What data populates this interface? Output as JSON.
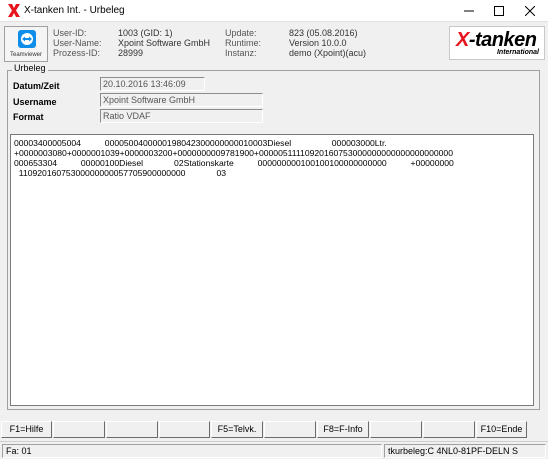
{
  "window": {
    "title": "X-tanken Int. - Urbeleg",
    "icons": {
      "app": "x-logo-icon",
      "minimize": "minimize-icon",
      "maximize": "maximize-icon",
      "close": "close-icon"
    }
  },
  "header": {
    "teamviewer_label": "Teamviewer",
    "teamviewer_icon": "teamviewer-icon",
    "user_id_label": "User-ID:",
    "user_id_value": "1003 (GID: 1)",
    "user_name_label": "User-Name:",
    "user_name_value": "Xpoint Software GmbH",
    "process_id_label": "Prozess-ID:",
    "process_id_value": "28999",
    "update_label": "Update:",
    "update_value": "823 (05.08.2016)",
    "runtime_label": "Runtime:",
    "runtime_value": "Version 10.0.0",
    "instance_label": "Instanz:",
    "instance_value": "demo (Xpoint)(acu)",
    "brand_x": "X",
    "brand_rest": "-tanken",
    "brand_sub": "International",
    "brand_color": "#e8141d"
  },
  "urbeleg": {
    "group_title": "Urbeleg",
    "datetime_label": "Datum/Zeit",
    "datetime_value": "20.10.2016 13:46:09",
    "username_label": "Username",
    "username_value": "Xpoint Software GmbH",
    "format_label": "Format",
    "format_value": "Ratio VDAF",
    "raw_lines": [
      "00003400005004          0000500400000198042300000000010003Diesel                 000003000Ltr.",
      "+0000003080+0000001039+0000003200+0000000009781900+00000511110920160753000000000000000000000",
      "000653304          00000100Diesel             02Stationskarte          000000000100100100000000000          +00000000",
      "  11092016075300000000057705900000000             03"
    ]
  },
  "fkeys": [
    "F1=Hilfe",
    "",
    "",
    "",
    "F5=Telvk.",
    "",
    "F8=F-Info",
    "",
    "F10=Ende"
  ],
  "status": {
    "left": "Fa: 01",
    "right": "tkurbeleg:C 4NL0-81PF-DELN S"
  }
}
